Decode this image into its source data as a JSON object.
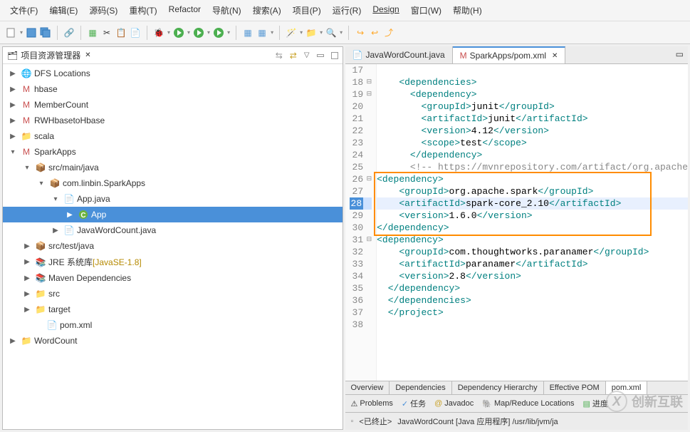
{
  "menu": {
    "file": "文件(F)",
    "edit": "编辑(E)",
    "source": "源码(S)",
    "refactor_cn": "重构(T)",
    "refactor_en": "Refactor",
    "navigate": "导航(N)",
    "search": "搜索(A)",
    "project": "项目(P)",
    "run": "运行(R)",
    "design": "Design",
    "window": "窗口(W)",
    "help": "帮助(H)"
  },
  "project_explorer_title": "项目资源管理器",
  "tree": {
    "dfs": "DFS Locations",
    "hbase": "hbase",
    "membercount": "MemberCount",
    "rwh": "RWHbasetoHbase",
    "scala": "scala",
    "sparkapps": "SparkApps",
    "srcmainjava": "src/main/java",
    "pkg": "com.linbin.SparkApps",
    "appjava": "App.java",
    "app": "App",
    "jwc": "JavaWordCount.java",
    "srctestjava": "src/test/java",
    "jre": "JRE 系统库",
    "jre_ver": "[JavaSE-1.8]",
    "maven": "Maven Dependencies",
    "src": "src",
    "target": "target",
    "pom": "pom.xml",
    "wordcount": "WordCount"
  },
  "editor": {
    "tab1": "JavaWordCount.java",
    "tab2": "SparkApps/pom.xml"
  },
  "lines": {
    "l17": "17",
    "l18": "18",
    "l19": "19",
    "l20": "20",
    "l21": "21",
    "l22": "22",
    "l23": "23",
    "l24": "24",
    "l25": "25",
    "l26": "26",
    "l27": "27",
    "l28": "28",
    "l29": "29",
    "l30": "30",
    "l31": "31",
    "l32": "32",
    "l33": "33",
    "l34": "34",
    "l35": "35",
    "l36": "36",
    "l37": "37",
    "l38": "38"
  },
  "code": {
    "c18a": "    <dependencies>",
    "c19a": "      <dependency>",
    "c20a": "        <groupId>",
    "c20b": "junit",
    "c20c": "</groupId>",
    "c21a": "        <artifactId>",
    "c21b": "junit",
    "c21c": "</artifactId>",
    "c22a": "        <version>",
    "c22b": "4.12",
    "c22c": "</version>",
    "c23a": "        <scope>",
    "c23b": "test",
    "c23c": "</scope>",
    "c24a": "      </dependency>",
    "c25a": "      <!-- https://mvnrepository.com/artifact/org.apache",
    "c26a": "<dependency>",
    "c27a": "    <groupId>",
    "c27b": "org.apache.spark",
    "c27c": "</groupId>",
    "c28a": "    <artifactId>",
    "c28b": "spark-core_2.10",
    "c28c": "</artifactId>",
    "c29a": "    <version>",
    "c29b": "1.6.0",
    "c29c": "</version>",
    "c30a": "</dependency>",
    "c31a": "<dependency>",
    "c32a": "    <groupId>",
    "c32b": "com.thoughtworks.paranamer",
    "c32c": "</groupId>",
    "c33a": "    <artifactId>",
    "c33b": "paranamer",
    "c33c": "</artifactId>",
    "c34a": "    <version>",
    "c34b": "2.8",
    "c34c": "</version>",
    "c35a": "  </dependency>",
    "c36a": "  </dependencies>",
    "c37a": "  </project>"
  },
  "pom_tabs": {
    "overview": "Overview",
    "deps": "Dependencies",
    "hier": "Dependency Hierarchy",
    "eff": "Effective POM",
    "pomxml": "pom.xml"
  },
  "views": {
    "problems": "Problems",
    "tasks": "任务",
    "javadoc": "Javadoc",
    "mapreduce": "Map/Reduce Locations",
    "progress": "进度"
  },
  "status": {
    "state": "<已终止>",
    "app": "JavaWordCount [Java 应用程序] /usr/lib/jvm/ja"
  },
  "watermark": "创新互联"
}
